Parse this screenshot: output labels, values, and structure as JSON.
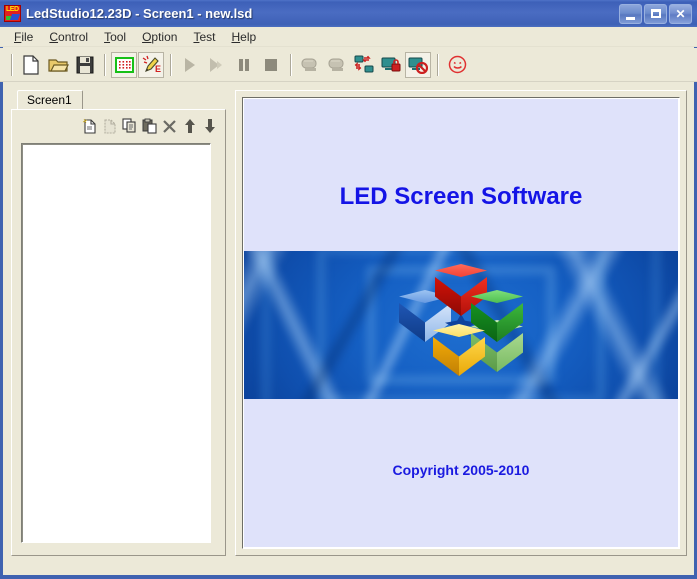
{
  "window": {
    "title": "LedStudio12.23D - Screen1 - new.lsd",
    "app_icon": "led-app-icon",
    "titlebar_color": "#3d60b8",
    "controls": {
      "minimize": "Minimize",
      "maximize": "Maximize",
      "close": "Close"
    }
  },
  "menubar": {
    "items": [
      {
        "label": "File",
        "accel": "F"
      },
      {
        "label": "Control",
        "accel": "C"
      },
      {
        "label": "Tool",
        "accel": "T"
      },
      {
        "label": "Option",
        "accel": "O"
      },
      {
        "label": "Test",
        "accel": "T"
      },
      {
        "label": "Help",
        "accel": "H"
      }
    ]
  },
  "toolbar": {
    "buttons": [
      {
        "name": "new-file-icon",
        "tooltip": "New",
        "state": "enabled"
      },
      {
        "name": "open-file-icon",
        "tooltip": "Open",
        "state": "enabled"
      },
      {
        "name": "save-file-icon",
        "tooltip": "Save",
        "state": "enabled"
      },
      {
        "name": "grid-screen-icon",
        "tooltip": "Screen Setup",
        "state": "pressed"
      },
      {
        "name": "edit-pencil-icon",
        "tooltip": "Edit",
        "state": "pressed"
      },
      {
        "name": "play-icon",
        "tooltip": "Play",
        "state": "disabled"
      },
      {
        "name": "fast-forward-icon",
        "tooltip": "Next",
        "state": "disabled"
      },
      {
        "name": "pause-icon",
        "tooltip": "Pause",
        "state": "disabled"
      },
      {
        "name": "stop-icon",
        "tooltip": "Stop",
        "state": "disabled"
      },
      {
        "name": "monitor-a-icon",
        "tooltip": "Display A",
        "state": "disabled"
      },
      {
        "name": "monitor-b-icon",
        "tooltip": "Display B",
        "state": "disabled"
      },
      {
        "name": "sync-screens-icon",
        "tooltip": "Sync",
        "state": "enabled"
      },
      {
        "name": "lock-screen-icon",
        "tooltip": "Lock Screen",
        "state": "enabled"
      },
      {
        "name": "block-screen-icon",
        "tooltip": "Blackout",
        "state": "pressed"
      },
      {
        "name": "smiley-face-icon",
        "tooltip": "About",
        "state": "enabled"
      }
    ]
  },
  "left_panel": {
    "tabs": [
      {
        "label": "Screen1",
        "selected": true
      }
    ],
    "mini_toolbar": [
      {
        "name": "new-item-icon",
        "tooltip": "New Item",
        "state": "enabled"
      },
      {
        "name": "new-page-icon",
        "tooltip": "New Page",
        "state": "disabled"
      },
      {
        "name": "copy-icon",
        "tooltip": "Copy",
        "state": "enabled"
      },
      {
        "name": "paste-icon",
        "tooltip": "Paste",
        "state": "enabled"
      },
      {
        "name": "delete-x-icon",
        "tooltip": "Delete",
        "state": "enabled"
      },
      {
        "name": "move-up-icon",
        "tooltip": "Move Up",
        "state": "enabled"
      },
      {
        "name": "move-down-icon",
        "tooltip": "Move Down",
        "state": "enabled"
      }
    ],
    "list_items": []
  },
  "splash": {
    "title": "LED Screen Software",
    "copyright": "Copyright 2005-2010",
    "title_color": "#1414e6",
    "background_color": "#dfe2fa",
    "band_color": "#1560c4",
    "logo": {
      "name": "led-studio-cubes-logo",
      "cubes": [
        {
          "name": "cube-red",
          "color": "#e81b10"
        },
        {
          "name": "cube-blue",
          "color": "#2f6fd0"
        },
        {
          "name": "cube-green",
          "color": "#1e9e28"
        },
        {
          "name": "cube-ltgreen",
          "color": "#8cc978"
        },
        {
          "name": "cube-yellow",
          "color": "#ffcc22"
        }
      ]
    }
  }
}
